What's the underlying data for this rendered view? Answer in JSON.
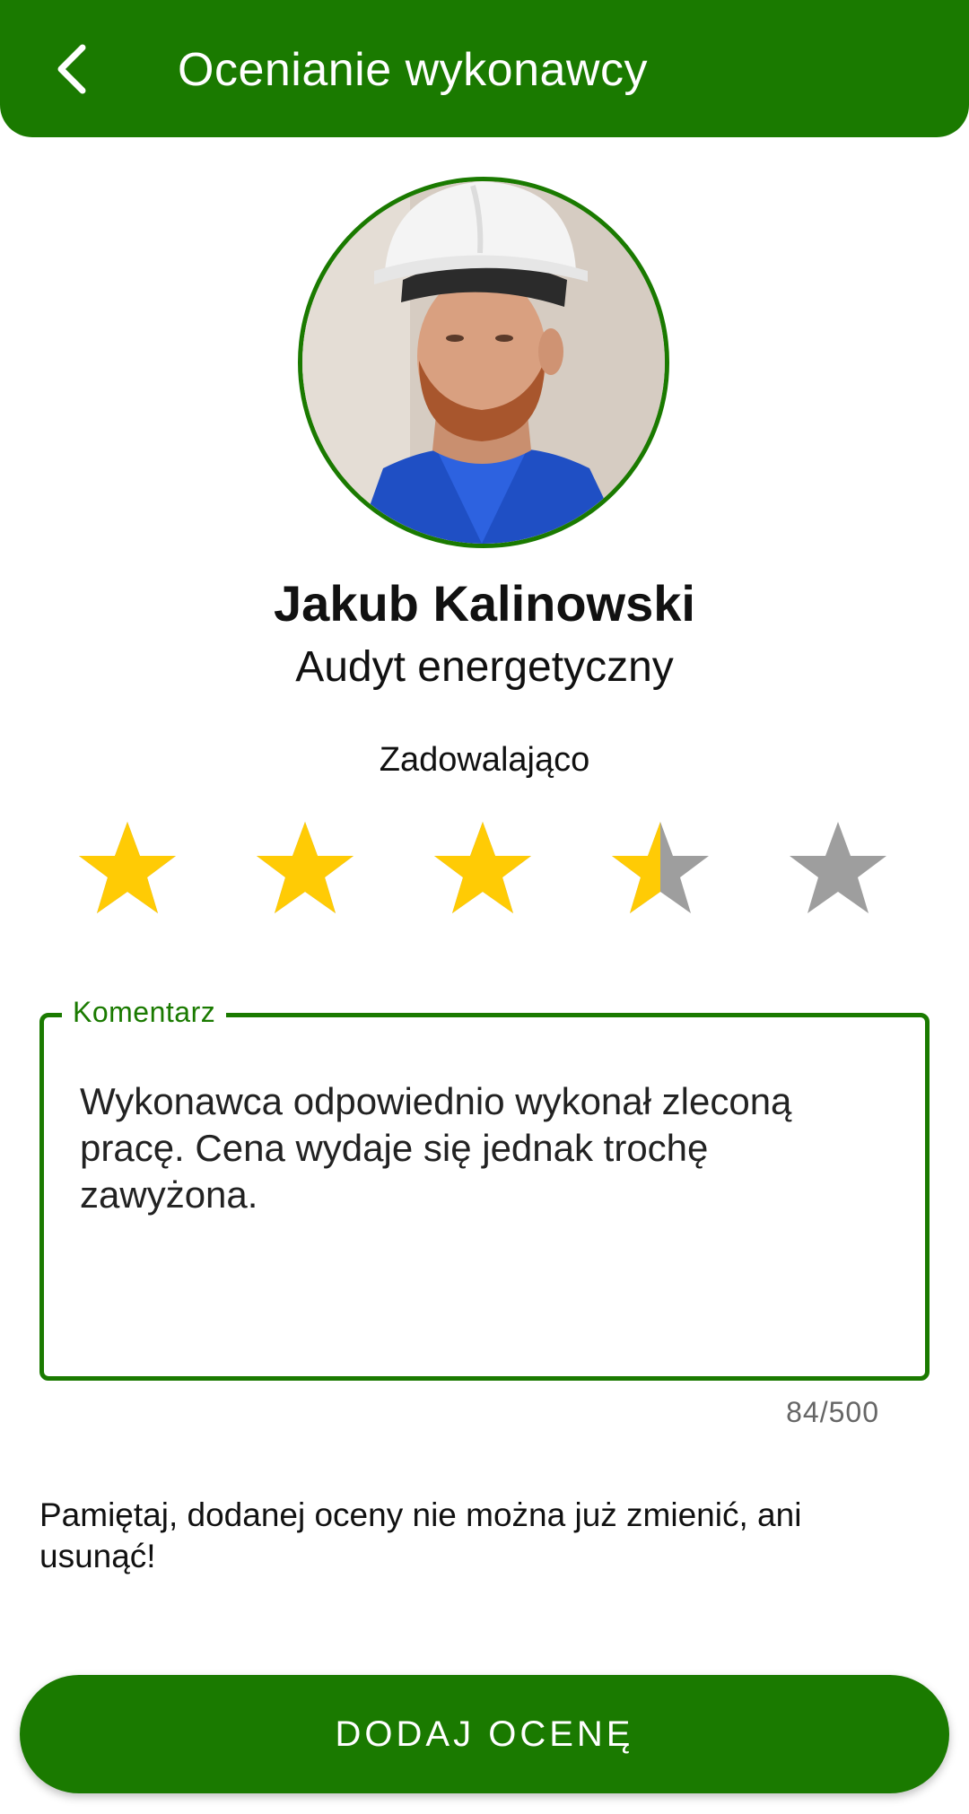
{
  "colors": {
    "primary_green": "#1a7a00",
    "star_filled": "#ffcb05",
    "star_empty": "#9e9e9e"
  },
  "app_bar": {
    "title": "Ocenianie wykonawcy",
    "back_icon": "chevron-left-icon"
  },
  "contractor": {
    "name": "Jakub Kalinowski",
    "service": "Audyt energetyczny"
  },
  "rating": {
    "label": "Zadowalająco",
    "value": 3.5,
    "max": 5
  },
  "comment": {
    "label": "Komentarz",
    "value": "Wykonawca odpowiednio wykonał zleconą pracę. Cena wydaje się jednak trochę zawyżona.",
    "counter": "84/500"
  },
  "warning": "Pamiętaj, dodanej oceny nie można już zmienić, ani usunąć!",
  "submit_label": "DODAJ OCENĘ"
}
